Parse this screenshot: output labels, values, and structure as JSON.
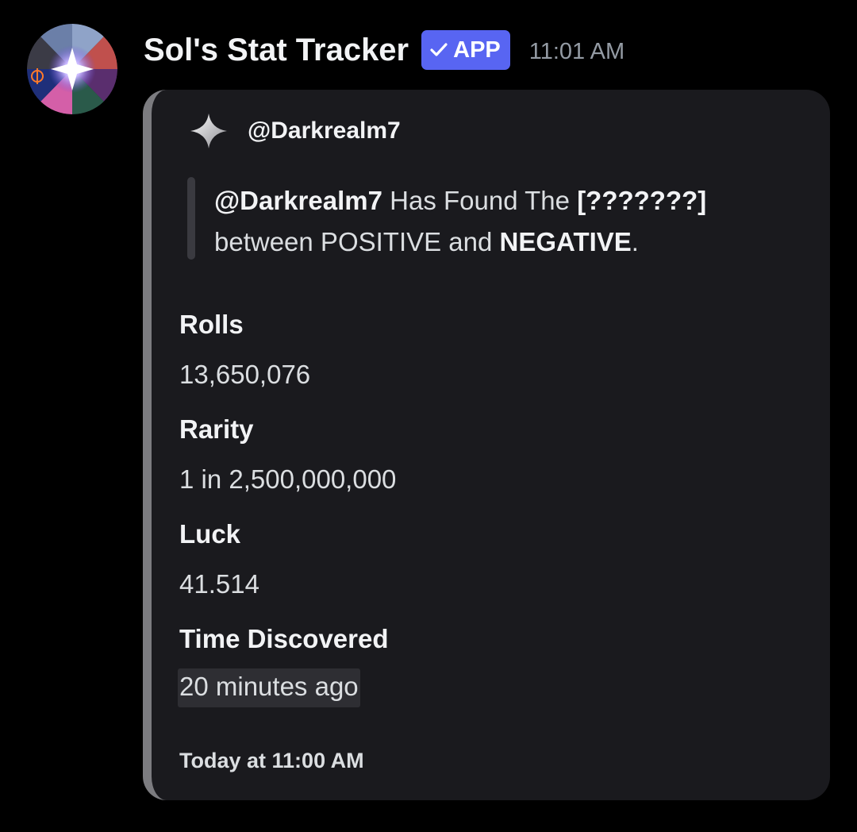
{
  "message": {
    "bot_name": "Sol's Stat Tracker",
    "badge": {
      "check": "✓",
      "label": "APP"
    },
    "time": "11:01 AM",
    "avatar_icon": "sols-rng-aura-avatar"
  },
  "embed": {
    "accent_color": "#7c7c80",
    "author": {
      "icon": "four-point-star-icon",
      "name": "@Darkrealm7"
    },
    "description": {
      "mention": "@Darkrealm7",
      "text1": " Has Found The ",
      "aura": "[???????]",
      "text2": "between POSITIVE and ",
      "emph": "NEGATIVE",
      "end": "."
    },
    "fields": [
      {
        "name": "Rolls",
        "value": "13,650,076"
      },
      {
        "name": "Rarity",
        "value": "1 in 2,500,000,000"
      },
      {
        "name": "Luck",
        "value": "41.514"
      },
      {
        "name": "Time Discovered",
        "value": "20 minutes ago"
      }
    ],
    "footer": "Today at 11:00 AM"
  },
  "colors": {
    "background": "#000000",
    "embed_bg": "#1a1a1e",
    "badge": "#5865f2",
    "timestamp": "#949ba4"
  }
}
